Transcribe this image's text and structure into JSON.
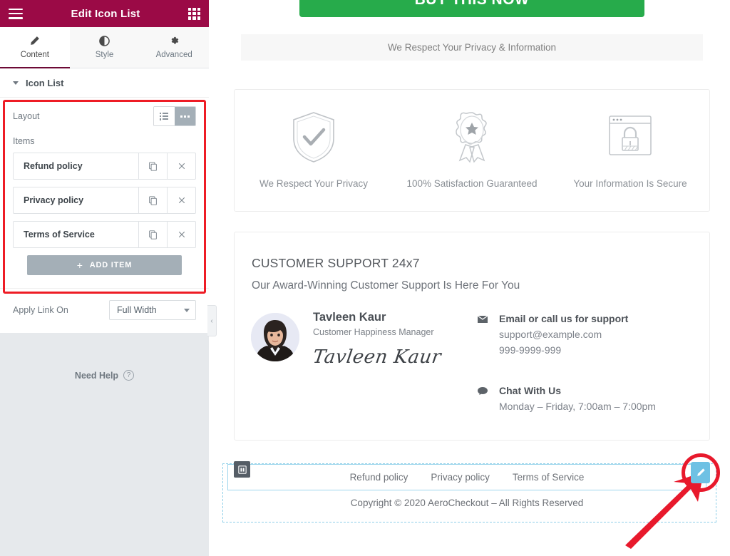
{
  "panel": {
    "header": {
      "title": "Edit Icon List",
      "menu_icon": "hamburger-icon",
      "apps_icon": "grid-apps-icon"
    },
    "tabs": [
      {
        "label": "Content",
        "icon": "pencil-icon",
        "active": true
      },
      {
        "label": "Style",
        "icon": "contrast-circle-icon",
        "active": false
      },
      {
        "label": "Advanced",
        "icon": "gear-icon",
        "active": false
      }
    ],
    "section": {
      "title": "Icon List",
      "caret": "caret-down-icon"
    },
    "layout": {
      "label": "Layout",
      "options": [
        {
          "name": "stacked",
          "icon": "list-icon",
          "selected": false
        },
        {
          "name": "inline",
          "icon": "dots-inline-icon",
          "selected": true
        }
      ]
    },
    "items_label": "Items",
    "items": [
      {
        "name": "Refund policy",
        "duplicate_icon": "copy-icon",
        "remove_icon": "close-icon"
      },
      {
        "name": "Privacy policy",
        "duplicate_icon": "copy-icon",
        "remove_icon": "close-icon"
      },
      {
        "name": "Terms of Service",
        "duplicate_icon": "copy-icon",
        "remove_icon": "close-icon"
      }
    ],
    "add_item": {
      "label": "ADD ITEM",
      "plus": "+"
    },
    "apply_link": {
      "label": "Apply Link On",
      "value": "Full Width"
    },
    "need_help": {
      "label": "Need Help",
      "icon": "question-circle-icon"
    },
    "collapse": {
      "icon": "chevron-left-icon",
      "glyph": "‹"
    }
  },
  "canvas": {
    "buy_button": "BUY THIS NOW",
    "privacy_bar": "We Respect Your Privacy & Information",
    "badges": [
      {
        "icon": "shield-check-icon",
        "label": "We Respect Your Privacy"
      },
      {
        "icon": "award-ribbon-icon",
        "label": "100% Satisfaction Guaranteed"
      },
      {
        "icon": "browser-lock-icon",
        "label": "Your Information Is Secure"
      }
    ],
    "support": {
      "title": "CUSTOMER SUPPORT 24x7",
      "subtitle": "Our Award-Winning Customer Support Is Here For You",
      "person": {
        "name": "Tavleen Kaur",
        "role": "Customer Happiness Manager",
        "signature": "Tavleen Kaur",
        "avatar": "person-photo-avatar"
      },
      "contact": {
        "icon": "envelope-icon",
        "title": "Email or call us for support",
        "email": "support@example.com",
        "phone": "999-9999-999"
      },
      "chat": {
        "icon": "chat-bubble-icon",
        "title": "Chat With Us",
        "hours": "Monday – Friday, 7:00am – 7:00pm"
      }
    },
    "footer": {
      "links": [
        "Refund policy",
        "Privacy policy",
        "Terms of Service"
      ],
      "copyright": "Copyright © 2020 AeroCheckout – All Rights Reserved",
      "column_handle_icon": "column-handle-icon",
      "section_toolbar": [
        {
          "name": "add-section",
          "icon": "plus-icon",
          "glyph": "+"
        },
        {
          "name": "edit-section",
          "icon": "grid-dots-icon"
        },
        {
          "name": "delete-section",
          "icon": "close-icon",
          "glyph": "×"
        }
      ],
      "edit_widget": {
        "icon": "pencil-edit-icon",
        "highlight": "red-circle-annotation"
      },
      "annotation_arrow": "red-arrow-annotation"
    }
  },
  "colors": {
    "header_maroon": "#9b0a46",
    "tab_active_underline": "#6d0a35",
    "buy_green": "#27ab4b",
    "elementor_blue": "#6ec1e4",
    "annotation_red": "#e8192c",
    "panel_grey": "#e6e9ec",
    "button_grey": "#a4afb7"
  }
}
